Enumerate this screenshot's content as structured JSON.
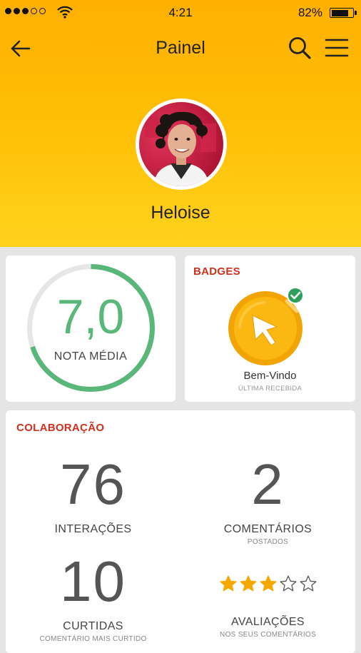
{
  "status_bar": {
    "time": "4:21",
    "battery": "82%"
  },
  "header": {
    "title": "Painel",
    "username": "Heloise"
  },
  "rating": {
    "value": "7,0",
    "label": "NOTA MÉDIA",
    "progress": 0.7
  },
  "badges": {
    "title": "BADGES",
    "name": "Bem-Vindo",
    "subtitle": "ÚLTIMA RECEBIDA"
  },
  "collab": {
    "title": "COLABORAÇÃO",
    "interactions": {
      "value": "76",
      "label": "INTERAÇÕES"
    },
    "comments": {
      "value": "2",
      "label": "COMENTÁRIOS",
      "sub": "POSTADOS"
    },
    "likes": {
      "value": "10",
      "label": "CURTIDAS",
      "sub": "COMENTÁRIO MAIS CURTIDO"
    },
    "reviews": {
      "stars": 3,
      "max_stars": 5,
      "label": "AVALIAÇÕES",
      "sub": "NOS SEUS COMENTÁRIOS"
    }
  },
  "colors": {
    "accent": "#ffb000",
    "green": "#59b77a",
    "red": "#d0301e"
  }
}
